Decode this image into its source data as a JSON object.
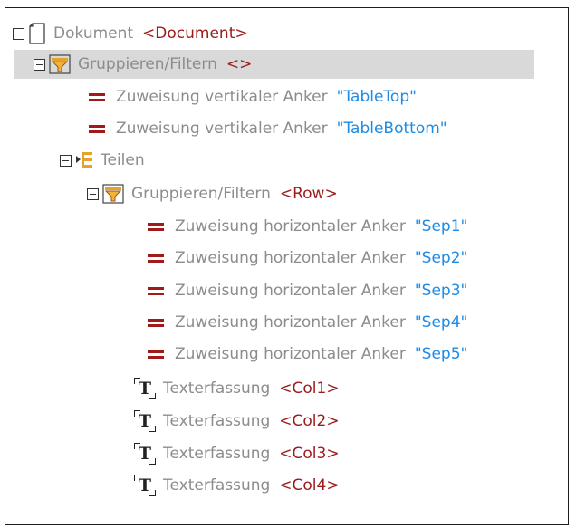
{
  "tree": {
    "document": {
      "label": "Dokument",
      "value": "<Document>"
    },
    "group1": {
      "label": "Gruppieren/Filtern",
      "value": "<>"
    },
    "vanchor1": {
      "label": "Zuweisung vertikaler Anker",
      "value": "\"TableTop\""
    },
    "vanchor2": {
      "label": "Zuweisung vertikaler Anker",
      "value": "\"TableBottom\""
    },
    "split": {
      "label": "Teilen"
    },
    "group2": {
      "label": "Gruppieren/Filtern",
      "value": "<Row>"
    },
    "hanchors": [
      {
        "label": "Zuweisung horizontaler Anker",
        "value": "\"Sep1\""
      },
      {
        "label": "Zuweisung horizontaler Anker",
        "value": "\"Sep2\""
      },
      {
        "label": "Zuweisung horizontaler Anker",
        "value": "\"Sep3\""
      },
      {
        "label": "Zuweisung horizontaler Anker",
        "value": "\"Sep4\""
      },
      {
        "label": "Zuweisung horizontaler Anker",
        "value": "\"Sep5\""
      }
    ],
    "texts": [
      {
        "label": "Texterfassung",
        "value": "<Col1>"
      },
      {
        "label": "Texterfassung",
        "value": "<Col2>"
      },
      {
        "label": "Texterfassung",
        "value": "<Col3>"
      },
      {
        "label": "Texterfassung",
        "value": "<Col4>"
      }
    ]
  },
  "icons": {
    "document": "document-icon",
    "filter": "filter-icon",
    "assign": "equals-icon",
    "split": "split-icon",
    "text": "text-capture-icon",
    "expand": "collapse-toggle-icon"
  },
  "colors": {
    "label": "#8c8c8c",
    "tag": "#9b1b1b",
    "string": "#1e8be6",
    "selection": "#d9d9d9"
  }
}
